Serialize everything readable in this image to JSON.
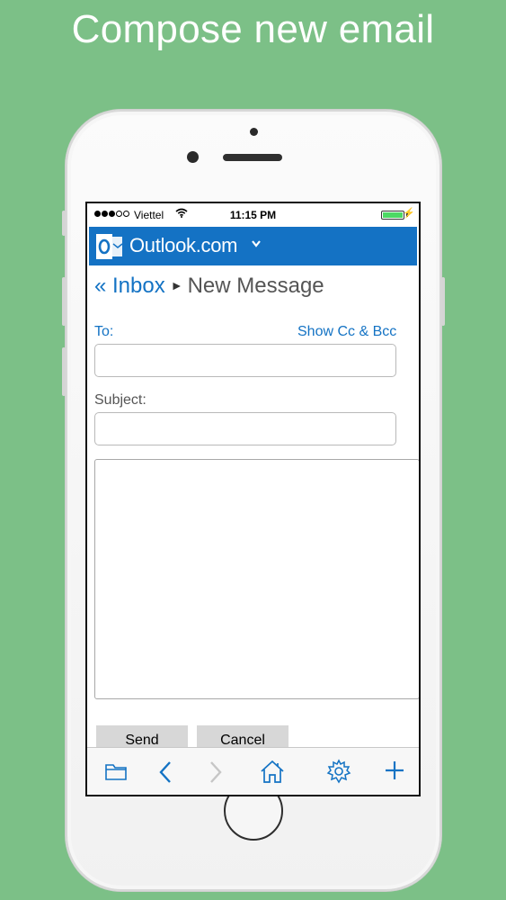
{
  "headline": "Compose new email",
  "status_bar": {
    "carrier": "Viettel",
    "time": "11:15 PM",
    "signal_bars_filled": 3,
    "signal_bars_total": 5,
    "battery_level": 1.0
  },
  "brand": {
    "name": "Outlook.com",
    "color": "#1472c4"
  },
  "breadcrumb": {
    "back_label": "« Inbox",
    "separator": "►",
    "current": "New Message"
  },
  "form": {
    "to_label": "To:",
    "show_cc_bcc": "Show Cc & Bcc",
    "to_value": "",
    "subject_label": "Subject:",
    "subject_value": "",
    "body_value": ""
  },
  "actions": {
    "send_label": "Send",
    "cancel_label": "Cancel"
  },
  "toolbar": {
    "icons": [
      "folder-icon",
      "back-arrow-icon",
      "forward-arrow-icon",
      "home-icon",
      "gear-icon",
      "plus-icon"
    ]
  },
  "colors": {
    "background": "#7cc087",
    "link": "#1473c4"
  }
}
